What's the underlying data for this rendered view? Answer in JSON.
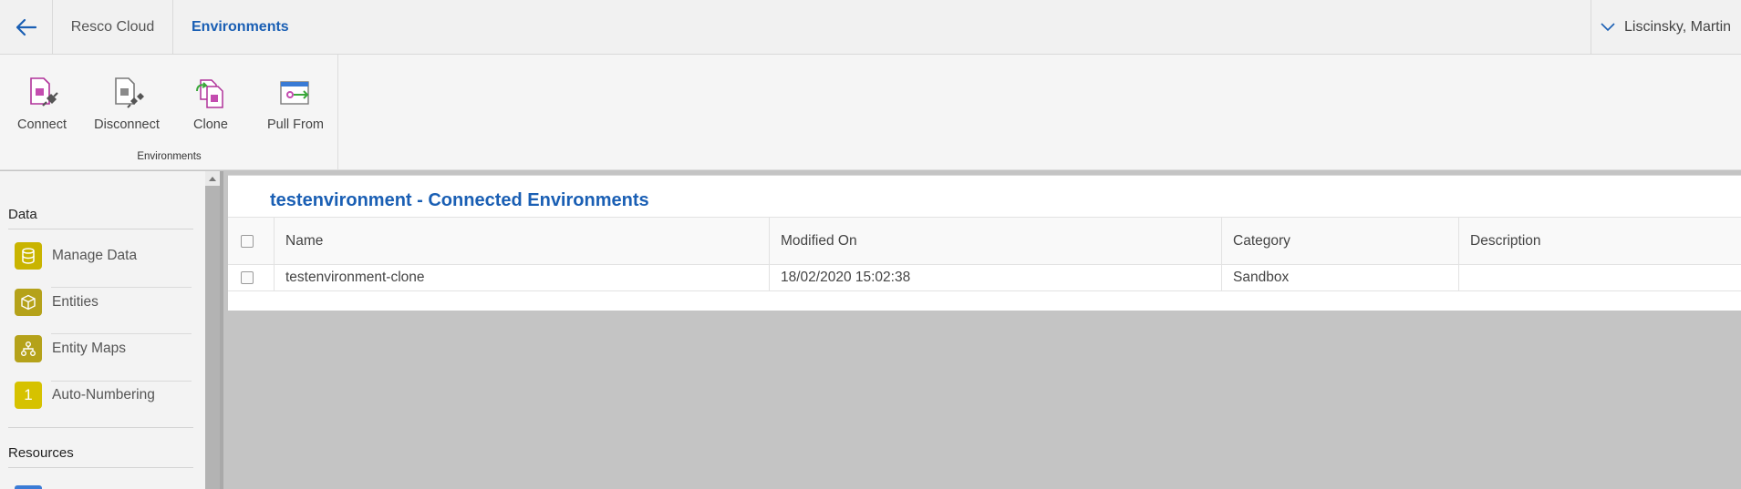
{
  "breadcrumb": {
    "root": "Resco Cloud",
    "current": "Environments"
  },
  "user": {
    "name": "Liscinsky, Martin"
  },
  "ribbon": {
    "buttons": [
      {
        "label": "Connect",
        "icon": "plug-connect-icon"
      },
      {
        "label": "Disconnect",
        "icon": "plug-disconnect-icon"
      },
      {
        "label": "Clone",
        "icon": "clone-icon"
      },
      {
        "label": "Pull From",
        "icon": "pull-from-icon"
      }
    ],
    "group_label": "Environments"
  },
  "sidebar": {
    "sections": [
      {
        "title": "Data",
        "items": [
          {
            "label": "Manage Data",
            "icon": "database-icon",
            "color": "#c9b400"
          },
          {
            "label": "Entities",
            "icon": "cube-icon",
            "color": "#b5a21a"
          },
          {
            "label": "Entity Maps",
            "icon": "hierarchy-icon",
            "color": "#b5a21a"
          },
          {
            "label": "Auto-Numbering",
            "icon": "number-one-icon",
            "glyph": "1",
            "color": "#d6c200"
          }
        ]
      },
      {
        "title": "Resources",
        "items": []
      }
    ]
  },
  "main": {
    "title": "testenvironment - Connected Environments",
    "columns": [
      "Name",
      "Modified On",
      "Category",
      "Description"
    ],
    "rows": [
      {
        "name": "testenvironment-clone",
        "modified_on": "18/02/2020 15:02:38",
        "category": "Sandbox",
        "description": ""
      }
    ]
  },
  "colors": {
    "accent": "#1a5fb4",
    "background": "#c4c4c4"
  }
}
